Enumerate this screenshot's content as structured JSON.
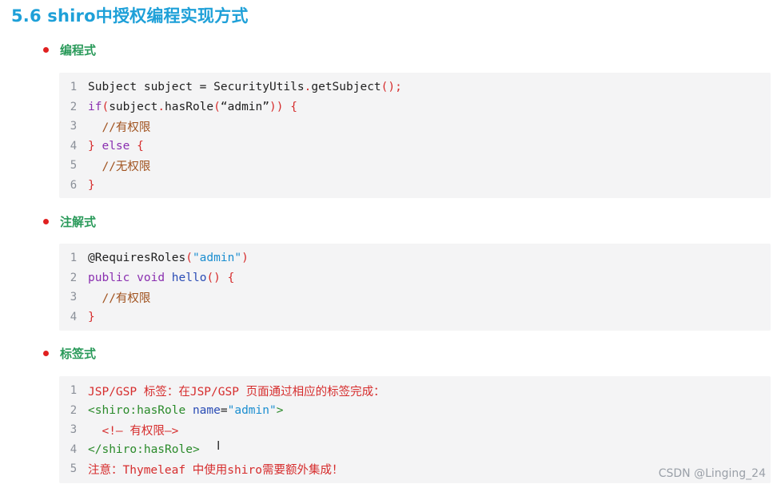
{
  "title": "5.6 shiro中授权编程实现方式",
  "sections": [
    {
      "label": "编程式",
      "lines": [
        {
          "n": "1",
          "parts": [
            {
              "t": "Subject subject = SecurityUtils",
              "c": "plain"
            },
            {
              "t": ".",
              "c": "red"
            },
            {
              "t": "getSubject",
              "c": "plain"
            },
            {
              "t": "();",
              "c": "red"
            }
          ]
        },
        {
          "n": "2",
          "parts": [
            {
              "t": "if",
              "c": "kw"
            },
            {
              "t": "(",
              "c": "red"
            },
            {
              "t": "subject",
              "c": "plain"
            },
            {
              "t": ".",
              "c": "red"
            },
            {
              "t": "hasRole",
              "c": "plain"
            },
            {
              "t": "(",
              "c": "red"
            },
            {
              "t": "“admin”",
              "c": "plain"
            },
            {
              "t": ")) {",
              "c": "red"
            }
          ]
        },
        {
          "n": "3",
          "parts": [
            {
              "t": "  //有权限",
              "c": "cmt"
            }
          ]
        },
        {
          "n": "4",
          "parts": [
            {
              "t": "} ",
              "c": "red"
            },
            {
              "t": "else",
              "c": "kw"
            },
            {
              "t": " {",
              "c": "red"
            }
          ]
        },
        {
          "n": "5",
          "parts": [
            {
              "t": "  //无权限",
              "c": "cmt"
            }
          ]
        },
        {
          "n": "6",
          "parts": [
            {
              "t": "}",
              "c": "red"
            }
          ]
        }
      ]
    },
    {
      "label": "注解式",
      "lines": [
        {
          "n": "1",
          "parts": [
            {
              "t": "@RequiresRoles",
              "c": "plain"
            },
            {
              "t": "(",
              "c": "red"
            },
            {
              "t": "\"admin\"",
              "c": "str"
            },
            {
              "t": ")",
              "c": "red"
            }
          ]
        },
        {
          "n": "2",
          "parts": [
            {
              "t": "public",
              "c": "kw"
            },
            {
              "t": " ",
              "c": "plain"
            },
            {
              "t": "void",
              "c": "kw"
            },
            {
              "t": " ",
              "c": "plain"
            },
            {
              "t": "hello",
              "c": "fn"
            },
            {
              "t": "() {",
              "c": "red"
            }
          ]
        },
        {
          "n": "3",
          "parts": [
            {
              "t": "  //有权限",
              "c": "cmt"
            }
          ]
        },
        {
          "n": "4",
          "parts": [
            {
              "t": "}",
              "c": "red"
            }
          ]
        }
      ]
    },
    {
      "label": "标签式",
      "lines": [
        {
          "n": "1",
          "parts": [
            {
              "t": "JSP/GSP 标签：在JSP/GSP 页面通过相应的标签完成：",
              "c": "red"
            }
          ]
        },
        {
          "n": "2",
          "parts": [
            {
              "t": "<shiro:hasRole ",
              "c": "tag"
            },
            {
              "t": "name",
              "c": "attr"
            },
            {
              "t": "=",
              "c": "plain"
            },
            {
              "t": "\"admin\"",
              "c": "str"
            },
            {
              "t": ">",
              "c": "tag"
            }
          ]
        },
        {
          "n": "3",
          "parts": [
            {
              "t": "  <!— 有权限—>",
              "c": "red"
            }
          ]
        },
        {
          "n": "4",
          "parts": [
            {
              "t": "</shiro:hasRole>",
              "c": "tag"
            }
          ]
        },
        {
          "n": "5",
          "parts": [
            {
              "t": "注意：Thymeleaf 中使用shiro需要额外集成！",
              "c": "red"
            }
          ]
        }
      ]
    }
  ],
  "watermark": "CSDN @Linging_24",
  "cursor_icon": "text-cursor-icon"
}
